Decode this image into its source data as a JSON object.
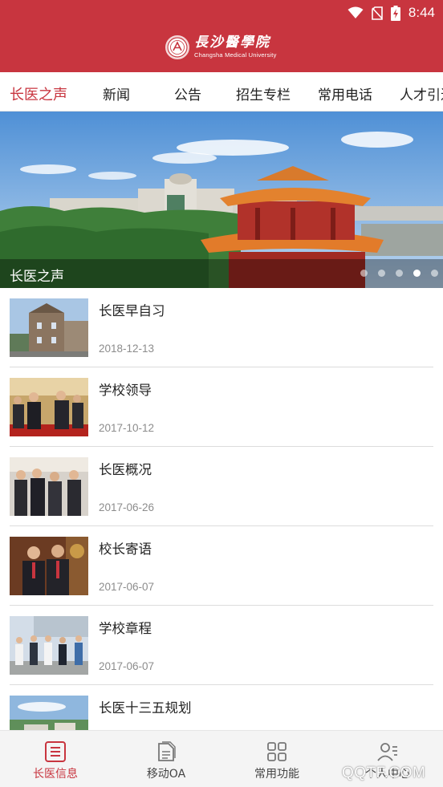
{
  "status_bar": {
    "time": "8:44"
  },
  "header": {
    "logo_cn": "長沙醫學院",
    "logo_en": "Changsha Medical University",
    "logo_badge": "CMU"
  },
  "tabs": [
    {
      "label": "长医之声",
      "active": true
    },
    {
      "label": "新闻",
      "active": false
    },
    {
      "label": "公告",
      "active": false
    },
    {
      "label": "招生专栏",
      "active": false
    },
    {
      "label": "常用电话",
      "active": false
    },
    {
      "label": "人才引进",
      "active": false
    }
  ],
  "banner": {
    "caption": "长医之声",
    "slide_count": 5,
    "active_slide": 4
  },
  "news": [
    {
      "title": "长医早自习",
      "date": "2018-12-13",
      "thumb": "building"
    },
    {
      "title": "学校领导",
      "date": "2017-10-12",
      "thumb": "handshake"
    },
    {
      "title": "长医概况",
      "date": "2017-06-26",
      "thumb": "group"
    },
    {
      "title": "校长寄语",
      "date": "2017-06-07",
      "thumb": "two-men"
    },
    {
      "title": "学校章程",
      "date": "2017-06-07",
      "thumb": "walking"
    },
    {
      "title": "长医十三五规划",
      "date": "",
      "thumb": "aerial"
    }
  ],
  "bottom_nav": [
    {
      "label": "长医信息",
      "icon": "news-list-icon",
      "active": true
    },
    {
      "label": "移动OA",
      "icon": "document-icon",
      "active": false
    },
    {
      "label": "常用功能",
      "icon": "grid-icon",
      "active": false
    },
    {
      "label": "个人中心",
      "icon": "user-profile-icon",
      "active": false
    }
  ],
  "watermark": "QQTF.COM",
  "colors": {
    "brand": "#c8353f",
    "date_gray": "#8c8c8c",
    "nav_bg": "#f4f4f4"
  }
}
